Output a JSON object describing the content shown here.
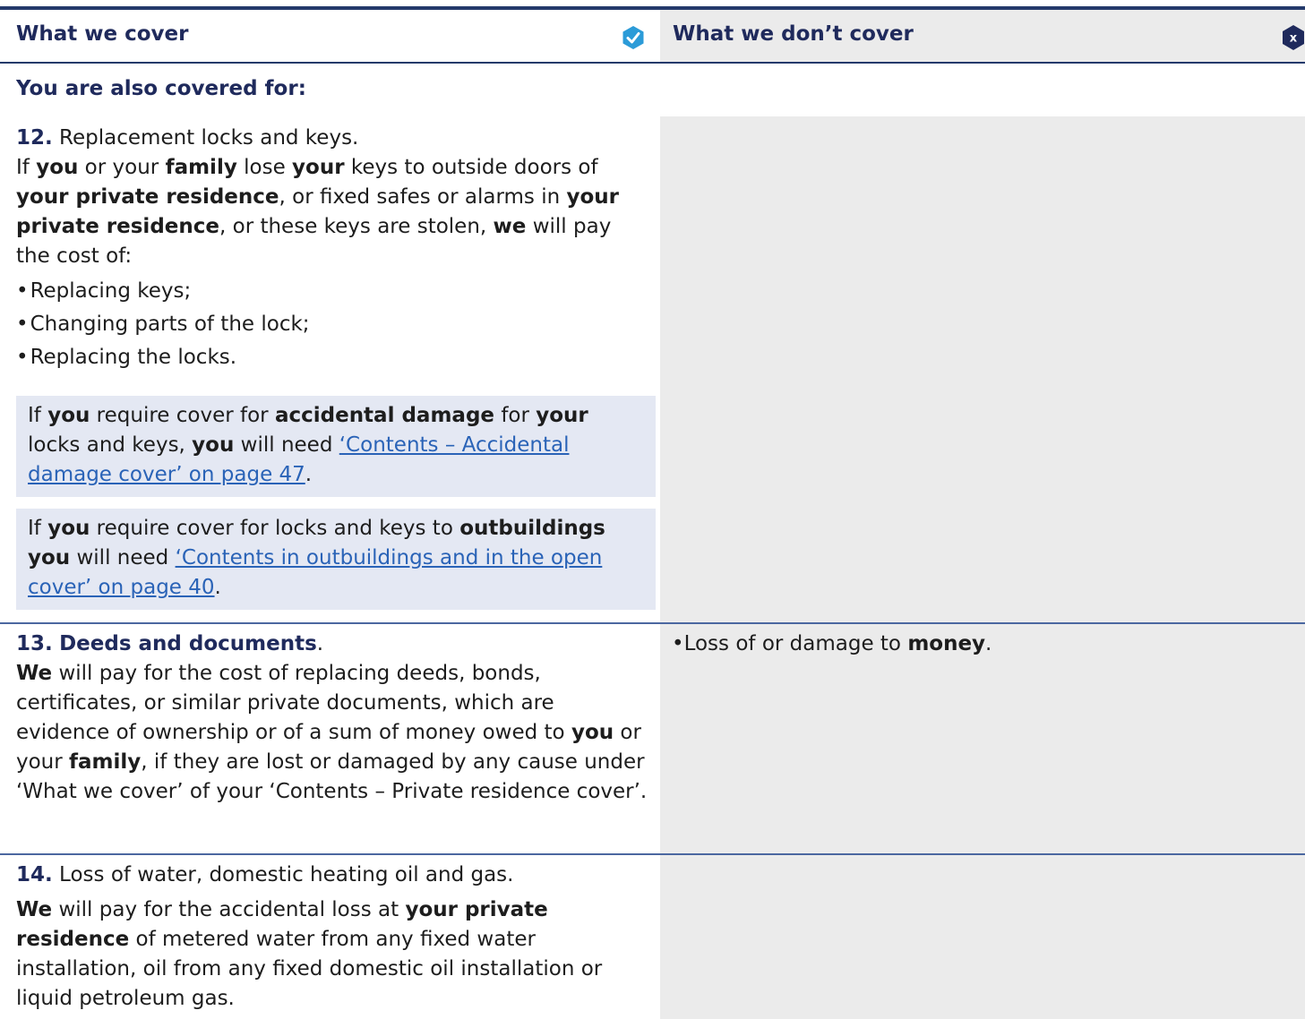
{
  "header": {
    "left_title": "What we cover",
    "right_title": "What we don’t cover",
    "colors": {
      "navy": "#1f2a5c",
      "rule": "#243a6b",
      "check_badge": "#2b9bd8",
      "x_badge": "#1f2a5c",
      "link": "#2a63b7"
    },
    "check_icon": "check-hexagon-icon",
    "x_icon": "x-hexagon-icon",
    "x_icon_label": "x"
  },
  "subheading": "You are also covered for:",
  "item12": {
    "number": "12.",
    "title": " Replacement locks and keys.",
    "para": {
      "t1": "If ",
      "b1": "you",
      "t2": " or your ",
      "b2": "family",
      "t3": " lose ",
      "b3": "your",
      "t4": " keys to outside doors of ",
      "b4": "your private residence",
      "t5": ", or fixed safes or alarms in ",
      "b5": "your private residence",
      "t6": ", or these keys are stolen, ",
      "b6": "we",
      "t7": " will pay the cost of:"
    },
    "bullets": [
      "Replacing keys;",
      "Changing parts of the lock;",
      "Replacing the locks."
    ],
    "note1": {
      "t1": "If ",
      "b1": "you",
      "t2": " require cover for ",
      "b2": "accidental damage",
      "t3": " for ",
      "b3": "your",
      "t4": " locks and keys, ",
      "b4": "you",
      "t5": " will need ",
      "link": "‘Contents – Accidental damage cover’ on page 47",
      "t6": "."
    },
    "note2": {
      "t1": "If ",
      "b1": "you",
      "t2": " require cover for locks and keys to ",
      "b2": "outbuildings you",
      "t3": " will need ",
      "link": "‘Contents in outbuildings and in the open cover’ on page 40",
      "t4": "."
    }
  },
  "item13": {
    "number": "13.",
    "title": "Deeds and documents",
    "title_end": ".",
    "para": {
      "b1": "We",
      "t1": " will pay for the cost of replacing deeds, bonds, certificates, or similar private documents, which are evidence of ownership or of a sum of money owed to ",
      "b2": "you",
      "t2": " or your ",
      "b3": "family",
      "t3": ", if they are lost or damaged by any cause under ‘What we cover’ of your ‘Contents – Private residence cover’."
    },
    "exclusion": {
      "t1": "Loss of or damage to ",
      "b1": "money",
      "t2": "."
    }
  },
  "item14": {
    "number": "14.",
    "title": " Loss of water, domestic heating oil and gas.",
    "para": {
      "b1": "We",
      "t1": " will pay for the accidental loss at ",
      "b2": "your private residence",
      "t2": " of metered water from any fixed water installation, oil from any fixed domestic oil installation or liquid petroleum gas."
    }
  }
}
